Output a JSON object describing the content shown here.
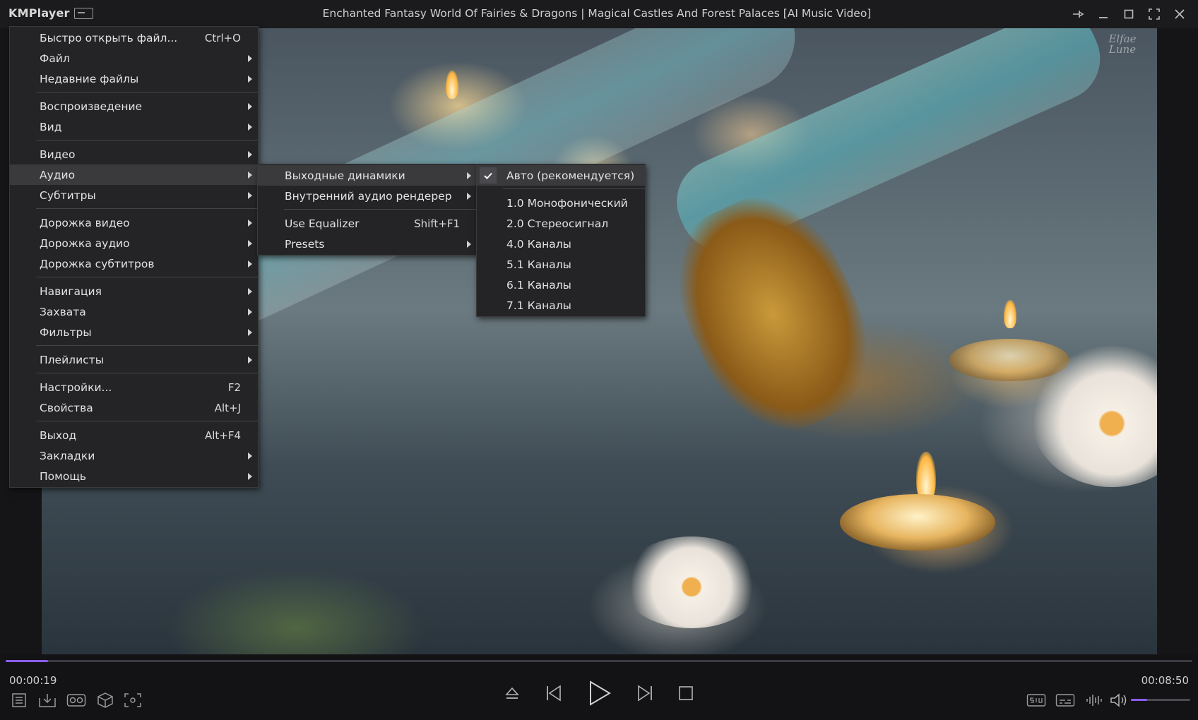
{
  "app": {
    "name": "KMPlayer"
  },
  "window": {
    "title": "Enchanted Fantasy World Of Fairies & Dragons | Magical Castles And Forest Palaces [AI Music Video]"
  },
  "watermark": {
    "line1": "Elfae",
    "line2": "Lune"
  },
  "main_menu": {
    "items": [
      {
        "label": "Быстро открыть файл...",
        "shortcut": "Ctrl+O"
      },
      {
        "label": "Файл",
        "submenu": true
      },
      {
        "label": "Недавние файлы",
        "submenu": true
      },
      {
        "label": "Воспроизведение",
        "submenu": true
      },
      {
        "label": "Вид",
        "submenu": true
      },
      {
        "label": "Видео",
        "submenu": true
      },
      {
        "label": "Аудио",
        "submenu": true,
        "highlighted": true
      },
      {
        "label": "Субтитры",
        "submenu": true
      },
      {
        "label": "Дорожка видео",
        "submenu": true
      },
      {
        "label": "Дорожка аудио",
        "submenu": true
      },
      {
        "label": "Дорожка субтитров",
        "submenu": true
      },
      {
        "label": "Навигация",
        "submenu": true
      },
      {
        "label": "Захвата",
        "submenu": true
      },
      {
        "label": "Фильтры",
        "submenu": true
      },
      {
        "label": "Плейлисты",
        "submenu": true
      },
      {
        "label": "Настройки...",
        "shortcut": "F2"
      },
      {
        "label": "Свойства",
        "shortcut": "Alt+J"
      },
      {
        "label": "Выход",
        "shortcut": "Alt+F4"
      },
      {
        "label": "Закладки",
        "submenu": true
      },
      {
        "label": "Помощь",
        "submenu": true
      }
    ]
  },
  "audio_menu": {
    "items": [
      {
        "label": "Выходные динамики",
        "submenu": true,
        "highlighted": true
      },
      {
        "label": "Внутренний аудио рендерер",
        "submenu": true
      },
      {
        "label": "Use Equalizer",
        "shortcut": "Shift+F1"
      },
      {
        "label": "Presets",
        "submenu": true
      }
    ]
  },
  "speakers_menu": {
    "items": [
      {
        "label": "Авто (рекомендуется)",
        "checked": true,
        "highlighted": true
      },
      {
        "label": "1.0 Монофонический"
      },
      {
        "label": "2.0 Стереосигнал"
      },
      {
        "label": "4.0 Каналы"
      },
      {
        "label": "5.1 Каналы"
      },
      {
        "label": "6.1 Каналы"
      },
      {
        "label": "7.1 Каналы"
      }
    ]
  },
  "playback": {
    "current_time": "00:00:19",
    "total_time": "00:08:50",
    "progress_fraction": 0.0358,
    "volume_fraction": 0.27
  },
  "colors": {
    "accent": "#8a5cf0",
    "menu_bg": "#242426",
    "highlight": "#3a3a3d"
  },
  "icons": {
    "left_controls": [
      "playlist-icon",
      "download-icon",
      "vr-icon",
      "3d-cube-icon",
      "screen-capture-icon"
    ],
    "center_controls": [
      "eject-icon",
      "previous-icon",
      "play-icon",
      "next-icon",
      "stop-icon"
    ],
    "right_controls": [
      "audio-channel-icon",
      "subtitle-icon",
      "equalizer-icon",
      "volume-icon"
    ]
  }
}
